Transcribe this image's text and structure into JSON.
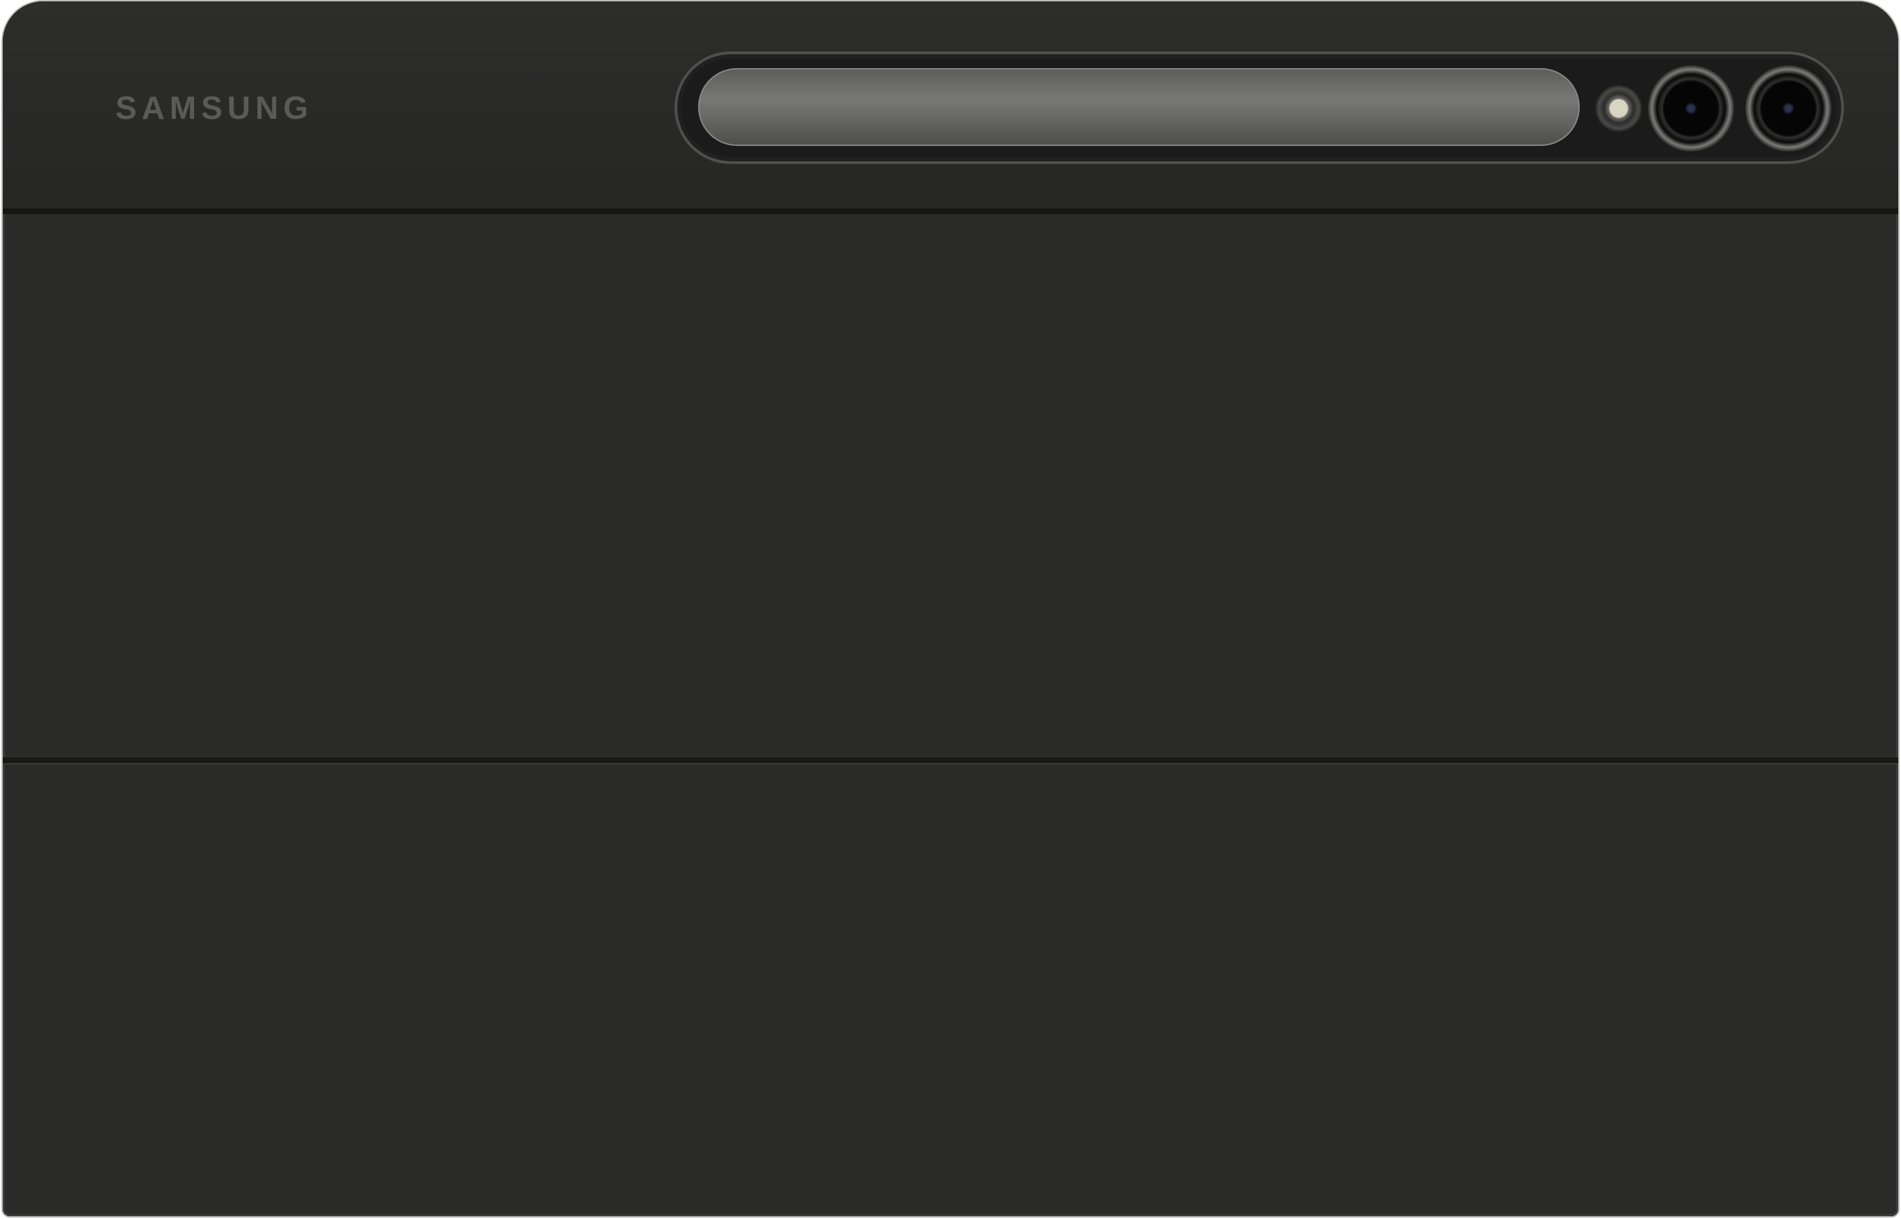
{
  "brand": {
    "text": "SAMSUNG"
  },
  "colors": {
    "cover": "#2a2a29",
    "top_band": "#2b2b2a",
    "brand_text": "#5a5a58",
    "pen": "#6f6f6d"
  }
}
